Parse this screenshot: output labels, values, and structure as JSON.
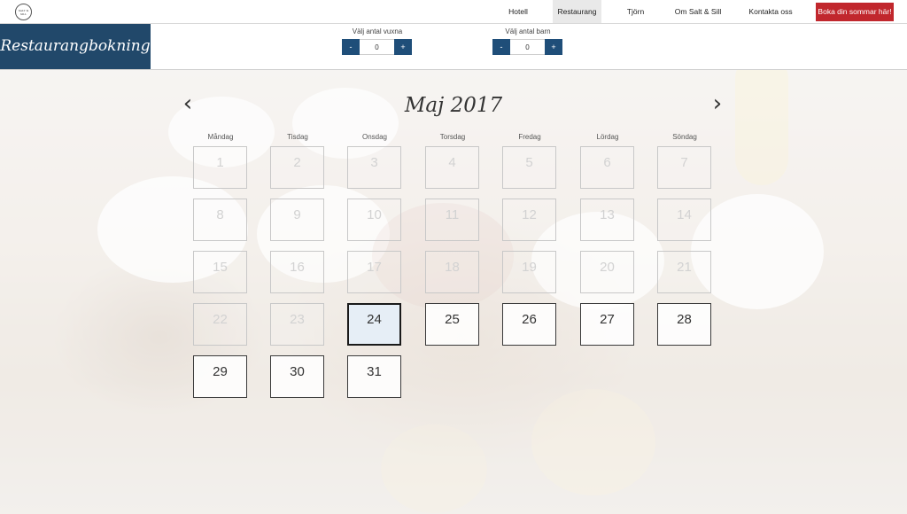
{
  "nav": {
    "logo_text": "SALT & SILL",
    "items": [
      {
        "label": "Hotell",
        "active": false
      },
      {
        "label": "Restaurang",
        "active": true
      },
      {
        "label": "Tjörn",
        "active": false
      },
      {
        "label": "Om Salt & Sill",
        "active": false
      },
      {
        "label": "Kontakta oss",
        "active": false
      }
    ],
    "cta_label": "Boka din sommar här!"
  },
  "header": {
    "title": "Restaurangbokning",
    "adults": {
      "label": "Välj antal vuxna",
      "minus": "-",
      "plus": "+",
      "value": "0"
    },
    "children": {
      "label": "Välj antal barn",
      "minus": "-",
      "plus": "+",
      "value": "0"
    }
  },
  "calendar": {
    "month_label": "Maj 2017",
    "prev_icon": "chevron-left-icon",
    "next_icon": "chevron-right-icon",
    "weekdays": [
      "Måndag",
      "Tisdag",
      "Onsdag",
      "Torsdag",
      "Fredag",
      "Lördag",
      "Söndag"
    ],
    "days": [
      "1",
      "2",
      "3",
      "4",
      "5",
      "6",
      "7",
      "8",
      "9",
      "10",
      "11",
      "12",
      "13",
      "14",
      "15",
      "16",
      "17",
      "18",
      "19",
      "20",
      "21",
      "22",
      "23",
      "24",
      "25",
      "26",
      "27",
      "28",
      "29",
      "30",
      "31"
    ],
    "today": "24",
    "first_available": "24"
  },
  "colors": {
    "brand": "#21486a",
    "accent": "#c1272d",
    "stepper": "#1f4e79",
    "today_bg": "#e6eef6"
  }
}
